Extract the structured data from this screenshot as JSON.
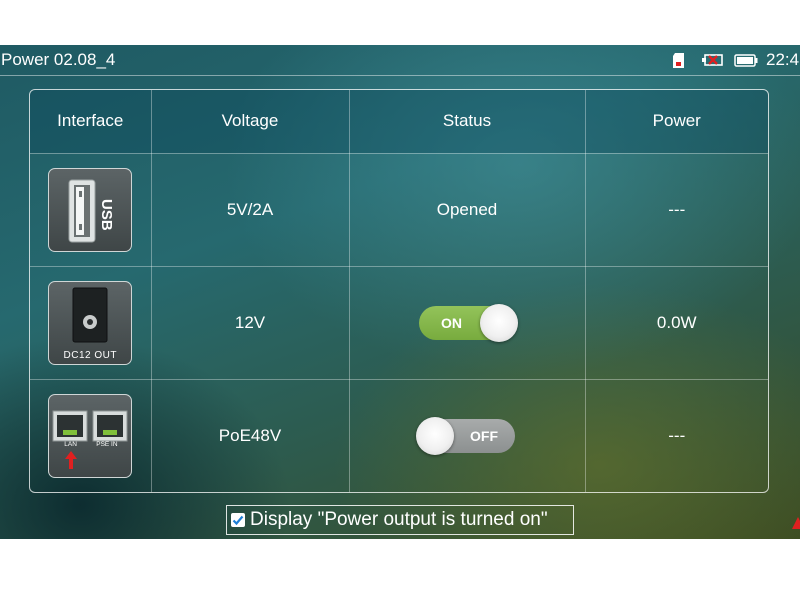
{
  "app": {
    "title": "Power 02.08_4",
    "time": "22:4"
  },
  "status_icons": [
    "sd-card-icon",
    "network-disconnected-icon",
    "battery-icon"
  ],
  "table": {
    "headers": [
      "Interface",
      "Voltage",
      "Status",
      "Power"
    ],
    "rows": [
      {
        "interface_icon": "usb-port-icon",
        "interface_label": "USB",
        "voltage": "5V/2A",
        "status": "Opened",
        "power": "---"
      },
      {
        "interface_icon": "dc-port-icon",
        "interface_label": "DC12 OUT",
        "voltage": "12V",
        "status_toggle": "ON",
        "toggle_state": true,
        "power": "0.0W"
      },
      {
        "interface_icon": "poe-port-icon",
        "interface_labels": [
          "LAN",
          "PSE IN"
        ],
        "voltage": "PoE48V",
        "status_toggle": "OFF",
        "toggle_state": false,
        "power": "---"
      }
    ]
  },
  "notice": {
    "checked": true,
    "text": "Display \"Power output is turned on\""
  },
  "colors": {
    "toggle_on": "#84b64a",
    "toggle_off": "#9a9d9d",
    "accent_red": "#e02020"
  }
}
